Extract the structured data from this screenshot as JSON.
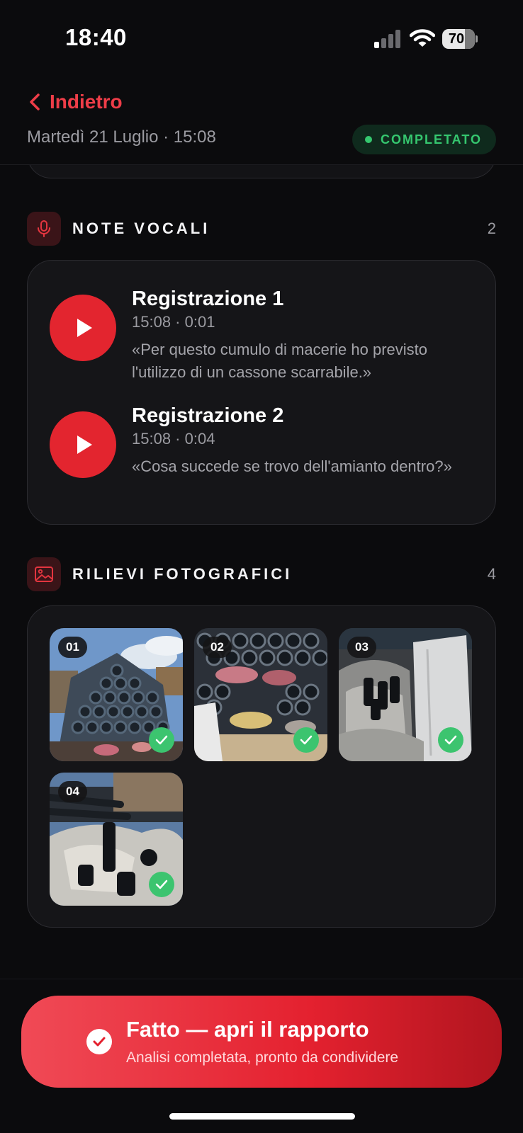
{
  "status_bar": {
    "time": "18:40",
    "battery": "70"
  },
  "header": {
    "back_label": "Indietro",
    "date": "Martedì 21 Luglio · 15:08",
    "status": "COMPLETATO"
  },
  "voice_notes": {
    "title": "NOTE VOCALI",
    "count": "2",
    "items": [
      {
        "title": "Registrazione 1",
        "meta": "15:08 · 0:01",
        "quote": "«Per questo cumulo di macerie ho previsto l'utilizzo di un cassone scarrabile.»"
      },
      {
        "title": "Registrazione 2",
        "meta": "15:08 · 0:04",
        "quote": "«Cosa succede se trovo dell'amianto dentro?»"
      }
    ]
  },
  "photos": {
    "title": "RILIEVI FOTOGRAFICI",
    "count": "4",
    "items": [
      {
        "number": "01"
      },
      {
        "number": "02"
      },
      {
        "number": "03"
      },
      {
        "number": "04"
      }
    ]
  },
  "cta": {
    "title": "Fatto — apri il rapporto",
    "subtitle": "Analisi completata, pronto da condividere"
  },
  "colors": {
    "accent": "#e3252f",
    "success": "#35c76f",
    "background": "#0b0b0d",
    "card": "#151518"
  }
}
